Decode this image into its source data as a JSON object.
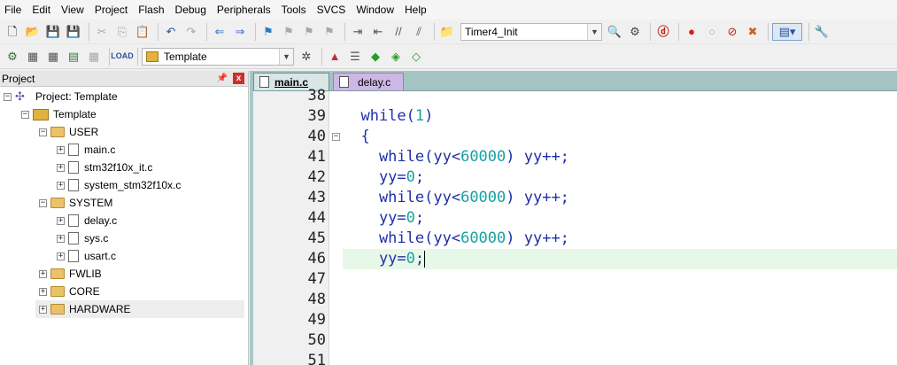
{
  "menubar": [
    "File",
    "Edit",
    "View",
    "Project",
    "Flash",
    "Debug",
    "Peripherals",
    "Tools",
    "SVCS",
    "Window",
    "Help"
  ],
  "toolbar1": {
    "function_combo": "Timer4_Init"
  },
  "toolbar2": {
    "target_combo": "Template"
  },
  "project_panel": {
    "title": "Project",
    "pin": " q",
    "close": "x",
    "tree": {
      "project": "Project: Template",
      "target": "Template",
      "groups": [
        {
          "name": "USER",
          "files": [
            "main.c",
            "stm32f10x_it.c",
            "system_stm32f10x.c"
          ]
        },
        {
          "name": "SYSTEM",
          "files": [
            "delay.c",
            "sys.c",
            "usart.c"
          ]
        },
        {
          "name": "FWLIB"
        },
        {
          "name": "CORE"
        },
        {
          "name": "HARDWARE"
        }
      ]
    }
  },
  "editor": {
    "tabs": [
      {
        "label": "main.c",
        "active": true
      },
      {
        "label": "delay.c",
        "active": false
      }
    ],
    "line_numbers": [
      "38",
      "39",
      "40",
      "41",
      "42",
      "43",
      "44",
      "45",
      "46",
      "47",
      "48",
      "49",
      "50",
      "51"
    ],
    "code": [
      {
        "ln": "38",
        "parts": []
      },
      {
        "ln": "39",
        "parts": [
          [
            "kw",
            "  while"
          ],
          [
            "pl",
            "("
          ],
          [
            "num",
            "1"
          ],
          [
            "pl",
            ")"
          ]
        ]
      },
      {
        "ln": "40",
        "parts": [
          [
            "pl",
            "  {"
          ]
        ]
      },
      {
        "ln": "41",
        "parts": [
          [
            "kw",
            "    while"
          ],
          [
            "pl",
            "(yy<"
          ],
          [
            "num",
            "60000"
          ],
          [
            "pl",
            ") yy++;"
          ]
        ]
      },
      {
        "ln": "42",
        "parts": [
          [
            "pl",
            "    yy="
          ],
          [
            "num",
            "0"
          ],
          [
            "pl",
            ";"
          ]
        ]
      },
      {
        "ln": "43",
        "parts": [
          [
            "kw",
            "    while"
          ],
          [
            "pl",
            "(yy<"
          ],
          [
            "num",
            "60000"
          ],
          [
            "pl",
            ") yy++;"
          ]
        ]
      },
      {
        "ln": "44",
        "parts": [
          [
            "pl",
            "    yy="
          ],
          [
            "num",
            "0"
          ],
          [
            "pl",
            ";"
          ]
        ]
      },
      {
        "ln": "45",
        "parts": [
          [
            "kw",
            "    while"
          ],
          [
            "pl",
            "(yy<"
          ],
          [
            "num",
            "60000"
          ],
          [
            "pl",
            ") yy++;"
          ]
        ]
      },
      {
        "ln": "46",
        "parts": [
          [
            "pl",
            "    yy="
          ],
          [
            "num",
            "0"
          ],
          [
            "pl",
            ";"
          ]
        ]
      },
      {
        "ln": "47",
        "parts": []
      },
      {
        "ln": "48",
        "parts": []
      },
      {
        "ln": "49",
        "parts": []
      },
      {
        "ln": "50",
        "parts": []
      }
    ],
    "current_line": "46",
    "fold_line": "40"
  },
  "colors": {
    "keyword": "#1f2fa8",
    "number": "#1aa0a0",
    "current_line_bg": "#e8f8e8",
    "tab_area_bg": "#a4c4c4",
    "delay_tab_bg": "#cdb7e4"
  }
}
